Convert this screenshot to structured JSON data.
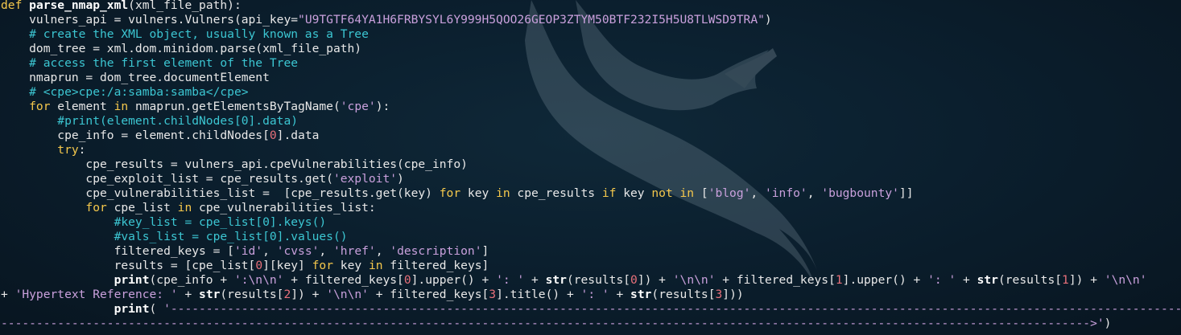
{
  "editor": {
    "theme_colors": {
      "background": "#0b1d2b",
      "text": "#e8e8e8",
      "keyword": "#f5c84c",
      "string": "#c9a0dc",
      "comment": "#3cc6d2",
      "number": "#e8707a"
    },
    "lines": [
      [
        [
          "kw",
          "def "
        ],
        [
          "fn",
          "parse_nmap_xml"
        ],
        [
          "txt",
          "(xml_file_path):"
        ]
      ],
      [
        [
          "txt",
          "    vulners_api = vulners.Vulners(api_key="
        ],
        [
          "str",
          "\"U9TGTF64YA1H6FRBYSYL6Y999H5QOO26GEOP3ZTYM50BTF232I5H5U8TLWSD9TRA\""
        ],
        [
          "txt",
          ")"
        ]
      ],
      [
        [
          "cm",
          "    # create the XML object, usually known as a Tree"
        ]
      ],
      [
        [
          "txt",
          "    dom_tree = xml.dom.minidom.parse(xml_file_path)"
        ]
      ],
      [
        [
          "cm",
          "    # access the first element of the Tree"
        ]
      ],
      [
        [
          "txt",
          "    nmaprun = dom_tree.documentElement"
        ]
      ],
      [
        [
          "cm",
          "    # <cpe>cpe:/a:samba:samba</cpe>"
        ]
      ],
      [
        [
          "kw",
          "    for "
        ],
        [
          "txt",
          "element "
        ],
        [
          "kw",
          "in "
        ],
        [
          "txt",
          "nmaprun.getElementsByTagName("
        ],
        [
          "str",
          "'cpe'"
        ],
        [
          "txt",
          "):"
        ]
      ],
      [
        [
          "cm",
          "        #print(element.childNodes[0].data)"
        ]
      ],
      [
        [
          "txt",
          "        cpe_info = element.childNodes["
        ],
        [
          "num",
          "0"
        ],
        [
          "txt",
          "].data"
        ]
      ],
      [
        [
          "kw",
          "        try"
        ],
        [
          "txt",
          ":"
        ]
      ],
      [
        [
          "txt",
          "            cpe_results = vulners_api.cpeVulnerabilities(cpe_info)"
        ]
      ],
      [
        [
          "txt",
          "            cpe_exploit_list = cpe_results.get("
        ],
        [
          "str",
          "'exploit'"
        ],
        [
          "txt",
          ")"
        ]
      ],
      [
        [
          "txt",
          "            cpe_vulnerabilities_list =  [cpe_results.get(key) "
        ],
        [
          "kw",
          "for "
        ],
        [
          "txt",
          "key "
        ],
        [
          "kw",
          "in "
        ],
        [
          "txt",
          "cpe_results "
        ],
        [
          "kw",
          "if "
        ],
        [
          "txt",
          "key "
        ],
        [
          "kw",
          "not in "
        ],
        [
          "txt",
          "["
        ],
        [
          "str",
          "'blog'"
        ],
        [
          "txt",
          ", "
        ],
        [
          "str",
          "'info'"
        ],
        [
          "txt",
          ", "
        ],
        [
          "str",
          "'bugbounty'"
        ],
        [
          "txt",
          "]]"
        ]
      ],
      [
        [
          "kw",
          "            for "
        ],
        [
          "txt",
          "cpe_list "
        ],
        [
          "kw",
          "in "
        ],
        [
          "txt",
          "cpe_vulnerabilities_list:"
        ]
      ],
      [
        [
          "cm",
          "                #key_list = cpe_list[0].keys()"
        ]
      ],
      [
        [
          "cm",
          "                #vals_list = cpe_list[0].values()"
        ]
      ],
      [
        [
          "txt",
          "                filtered_keys = ["
        ],
        [
          "str",
          "'id'"
        ],
        [
          "txt",
          ", "
        ],
        [
          "str",
          "'cvss'"
        ],
        [
          "txt",
          ", "
        ],
        [
          "str",
          "'href'"
        ],
        [
          "txt",
          ", "
        ],
        [
          "str",
          "'description'"
        ],
        [
          "txt",
          "]"
        ]
      ],
      [
        [
          "txt",
          "                results = [cpe_list["
        ],
        [
          "num",
          "0"
        ],
        [
          "txt",
          "][key] "
        ],
        [
          "kw",
          "for "
        ],
        [
          "txt",
          "key "
        ],
        [
          "kw",
          "in "
        ],
        [
          "txt",
          "filtered_keys]"
        ]
      ],
      [
        [
          "bi",
          "                print"
        ],
        [
          "txt",
          "(cpe_info + "
        ],
        [
          "str",
          "':\\n\\n'"
        ],
        [
          "txt",
          " + filtered_keys["
        ],
        [
          "num",
          "0"
        ],
        [
          "txt",
          "].upper() + "
        ],
        [
          "str",
          "': '"
        ],
        [
          "txt",
          " + "
        ],
        [
          "bi",
          "str"
        ],
        [
          "txt",
          "(results["
        ],
        [
          "num",
          "0"
        ],
        [
          "txt",
          "]) + "
        ],
        [
          "str",
          "'\\n\\n'"
        ],
        [
          "txt",
          " + filtered_keys["
        ],
        [
          "num",
          "1"
        ],
        [
          "txt",
          "].upper() + "
        ],
        [
          "str",
          "': '"
        ],
        [
          "txt",
          " + "
        ],
        [
          "bi",
          "str"
        ],
        [
          "txt",
          "(results["
        ],
        [
          "num",
          "1"
        ],
        [
          "txt",
          "]) + "
        ],
        [
          "str",
          "'\\n\\n'"
        ]
      ],
      [
        [
          "txt",
          "+ "
        ],
        [
          "str",
          "'Hypertext Reference: '"
        ],
        [
          "txt",
          " + "
        ],
        [
          "bi",
          "str"
        ],
        [
          "txt",
          "(results["
        ],
        [
          "num",
          "2"
        ],
        [
          "txt",
          "]) + "
        ],
        [
          "str",
          "'\\n\\n'"
        ],
        [
          "txt",
          " + filtered_keys["
        ],
        [
          "num",
          "3"
        ],
        [
          "txt",
          "].title() + "
        ],
        [
          "str",
          "': '"
        ],
        [
          "txt",
          " + "
        ],
        [
          "bi",
          "str"
        ],
        [
          "txt",
          "(results["
        ],
        [
          "num",
          "3"
        ],
        [
          "txt",
          "]))"
        ]
      ],
      [
        [
          "bi",
          "                print"
        ],
        [
          "txt",
          "( "
        ],
        [
          "str",
          "'--------------------------------------------------------------------------------------------------------------------------------------------------"
        ]
      ],
      [
        [
          "str",
          "---------------------------------------------------------------------------------------------------------------------------------------------------------->"
        ],
        [
          "str",
          "'"
        ],
        [
          "txt",
          ")"
        ]
      ]
    ]
  }
}
